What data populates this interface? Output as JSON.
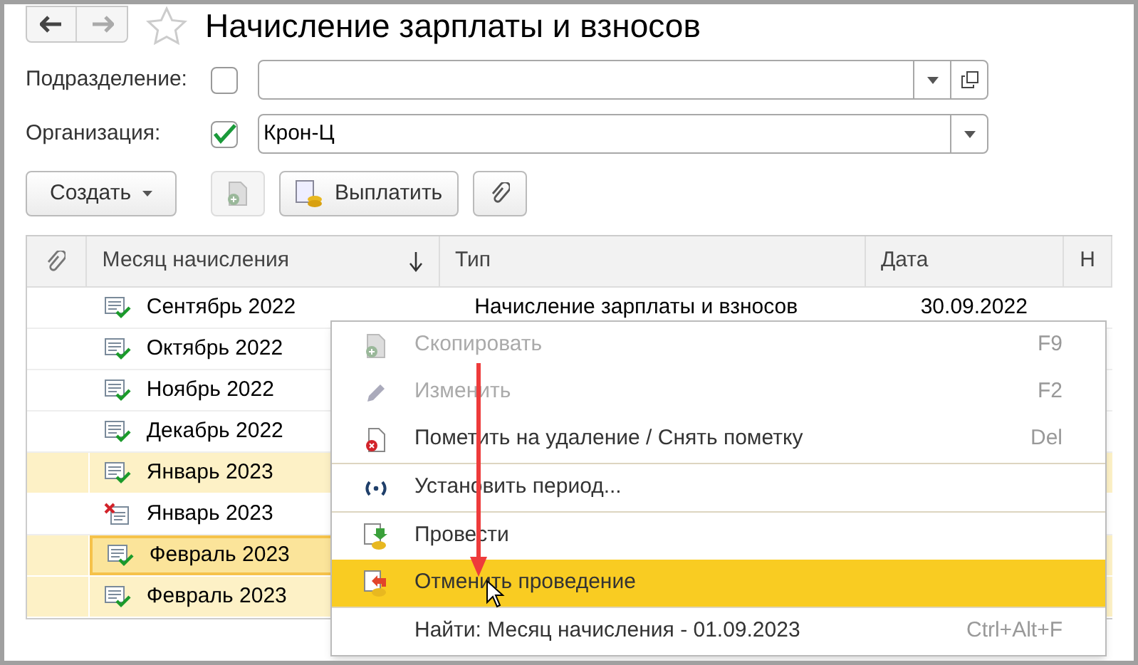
{
  "window": {
    "title": "Начисление зарплаты и взносов"
  },
  "filters": [
    {
      "label": "Подразделение:",
      "checked": false,
      "open_button": true
    },
    {
      "label": "Организация:",
      "checked": true,
      "value": "Крон-Ц",
      "open_button": false
    }
  ],
  "toolbar": {
    "create": "Создать",
    "pay": "Выплатить"
  },
  "table": {
    "columns": [
      {
        "label": "Месяц начисления",
        "sorted": true
      },
      {
        "label": "Тип",
        "sorted": false
      },
      {
        "label": "Дата",
        "sorted": false
      },
      {
        "label": "Н",
        "sorted": false
      }
    ],
    "rows": [
      {
        "month": "Сентябрь 2022",
        "type": "Начисление зарплаты и взносов",
        "date": "30.09.2022",
        "deleted": false,
        "highlighted": false,
        "selected": false
      },
      {
        "month": "Октябрь 2022",
        "deleted": false,
        "highlighted": false,
        "selected": false
      },
      {
        "month": "Ноябрь 2022",
        "deleted": false,
        "highlighted": false,
        "selected": false
      },
      {
        "month": "Декабрь 2022",
        "deleted": false,
        "highlighted": false,
        "selected": false
      },
      {
        "month": "Январь 2023",
        "deleted": false,
        "highlighted": true,
        "selected": false
      },
      {
        "month": "Январь 2023",
        "deleted": true,
        "highlighted": false,
        "selected": false
      },
      {
        "month": "Февраль 2023",
        "deleted": false,
        "highlighted": true,
        "selected": true
      },
      {
        "month": "Февраль 2023",
        "deleted": false,
        "highlighted": true,
        "selected": false
      }
    ]
  },
  "context_menu": [
    {
      "kind": "copy",
      "label": "Скопировать",
      "shortcut": "F9",
      "disabled": true,
      "selected": false,
      "separator_before": false
    },
    {
      "kind": "edit",
      "label": "Изменить",
      "shortcut": "F2",
      "disabled": true,
      "selected": false,
      "separator_before": false
    },
    {
      "kind": "delete",
      "label": "Пометить на удаление / Снять пометку",
      "shortcut": "Del",
      "disabled": false,
      "selected": false,
      "separator_before": false
    },
    {
      "kind": "period",
      "label": "Установить период...",
      "disabled": false,
      "selected": false,
      "separator_before": true
    },
    {
      "kind": "post",
      "label": "Провести",
      "disabled": false,
      "selected": false,
      "separator_before": true
    },
    {
      "kind": "unpost",
      "label": "Отменить проведение",
      "disabled": false,
      "selected": true,
      "separator_before": false
    },
    {
      "kind": "find",
      "label": "Найти: Месяц начисления - 01.09.2023",
      "shortcut": "Ctrl+Alt+F",
      "disabled": false,
      "selected": false,
      "separator_before": true
    }
  ]
}
